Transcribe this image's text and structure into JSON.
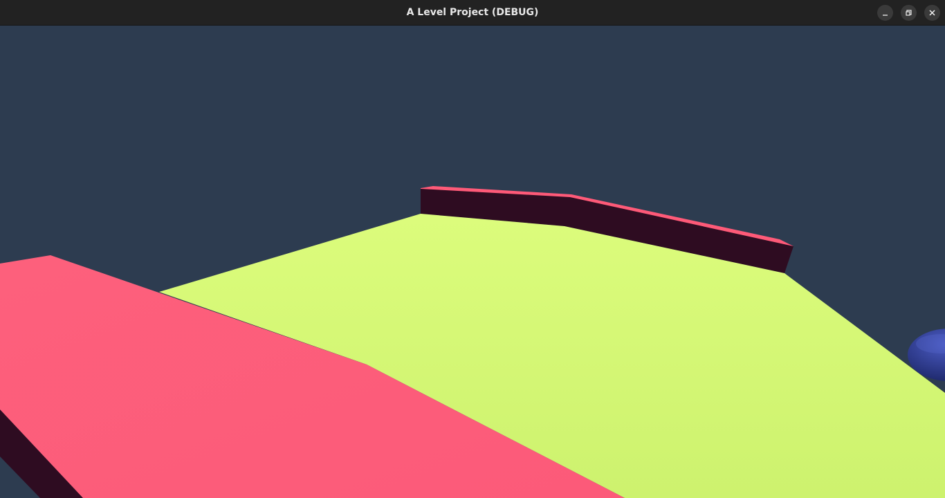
{
  "window": {
    "title": "A Level Project (DEBUG)",
    "buttons": {
      "minimize": "minimize-icon",
      "maximize": "restore-icon",
      "close": "close-icon"
    }
  },
  "scene": {
    "sky_color": "#2d3c50",
    "floor_color": "#d9fb78",
    "platform_color": "#fd5f7b",
    "wall_dark_color": "#2e0c21",
    "sphere_color": "#2e3c8f"
  }
}
